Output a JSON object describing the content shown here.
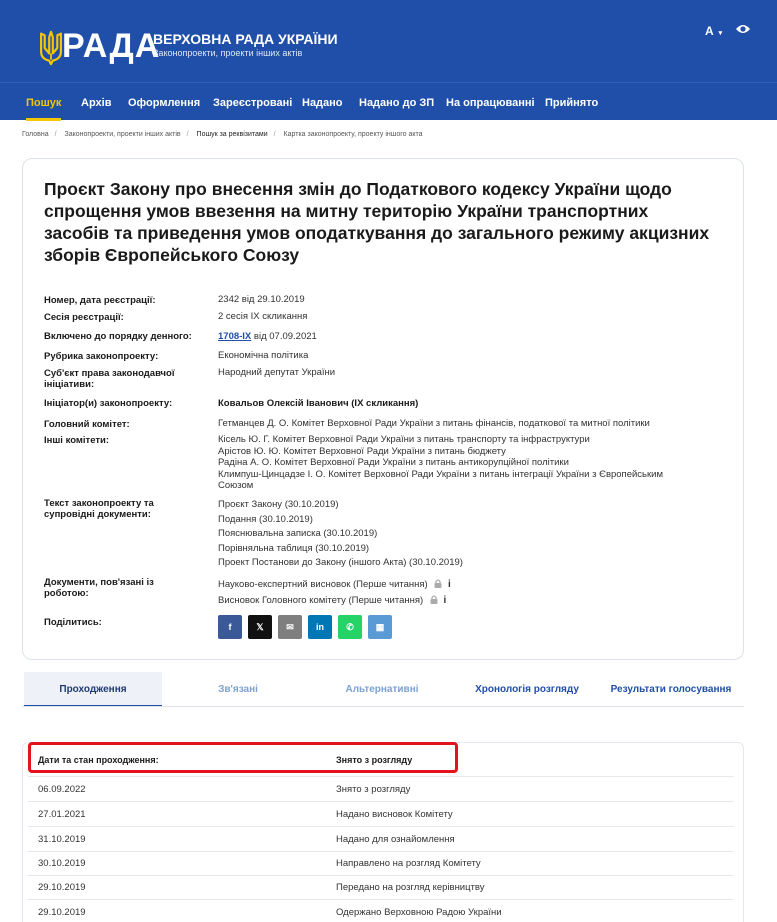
{
  "header": {
    "logo_text": "РАДА",
    "site_title": "ВЕРХОВНА РАДА УКРАЇНИ",
    "site_subtitle": "Законопроекти, проекти інших актів",
    "font_switch": "A",
    "brand_color": "#1f4fa8",
    "accent_color": "#f5c700"
  },
  "nav": {
    "items": [
      "Пошук",
      "Архів",
      "Оформлення",
      "Зареєстровані",
      "Надано",
      "Надано до ЗП",
      "На опрацюванні",
      "Прийнято"
    ],
    "active": "Пошук"
  },
  "breadcrumb": [
    "Головна",
    "Законопроекти, проекти інших актів",
    "Пошук за реквізитами",
    "Картка законопроекту, проекту іншого акта"
  ],
  "bill": {
    "title": "Проєкт Закону про внесення змін до Податкового кодексу України щодо спрощення умов ввезення на митну територію України транспортних засобів та приведення умов оподаткування до загального режиму акцизних зборів Європейського Союзу",
    "fields": {
      "reg_label": "Номер, дата реєстрації:",
      "reg_value": "2342 від 29.10.2019",
      "session_label": "Сесія реєстрації:",
      "session_value": "2 сесія IX скликання",
      "agenda_label": "Включено до порядку денного:",
      "agenda_number": "1708-IX",
      "agenda_date": "від 07.09.2021",
      "rubric_label": "Рубрика законопроекту:",
      "rubric_value": "Економічна політика",
      "subject_label": "Суб'єкт права законодавчої ініціативи:",
      "subject_value": "Народний депутат України",
      "initiator_label": "Ініціатор(и) законопроекту:",
      "initiator_value": "Ковальов Олексій Іванович (IX скликання)",
      "main_committee_label": "Головний комітет:",
      "main_committee_value": "Гетманцев Д. О. Комітет Верховної Ради України з питань фінансів, податкової та митної політики",
      "other_committees_label": "Інші комітети:",
      "other_committees": [
        "Кісель Ю. Г. Комітет Верховної Ради України з питань транспорту та інфраструктури",
        "Арістов Ю. Ю. Комітет Верховної Ради України з питань бюджету",
        "Радіна А. О. Комітет Верховної Ради України з питань антикорупційної політики",
        "Климпуш-Цинцадзе І. О. Комітет Верховної Ради України з питань інтеграції України з Європейським",
        "Союзом"
      ],
      "docs_label": "Текст законопроекту та супровідні документи:",
      "docs": [
        "Проєкт Закону (30.10.2019)",
        "Подання (30.10.2019)",
        "Пояснювальна записка (30.10.2019)",
        "Порівняльна таблиця (30.10.2019)",
        "Проект Постанови до Закону (іншого Акта) (30.10.2019)"
      ],
      "related_label": "Документи, пов'язані із роботою:",
      "related_docs": [
        "Науково-експертний висновок (Перше читання)",
        "Висновок Головного комітету (Перше читання)"
      ],
      "share_label": "Поділитись:"
    },
    "share_buttons": [
      {
        "label": "f",
        "color": "#3b5998"
      },
      {
        "label": "𝕏",
        "color": "#111111"
      },
      {
        "label": "✉",
        "color": "#7f7f7f"
      },
      {
        "label": "in",
        "color": "#0077b5"
      },
      {
        "label": "✆",
        "color": "#25d366"
      },
      {
        "label": "▦",
        "color": "#5b9bd5"
      }
    ]
  },
  "tabs": [
    "Проходження",
    "Зв'язані",
    "Альтернативні",
    "Хронологія розгляду",
    "Результати голосування"
  ],
  "table": {
    "header_date": "Дати та стан проходження:",
    "header_status": "Знято з розгляду",
    "rows": [
      {
        "date": "06.09.2022",
        "status": "Знято з розгляду"
      },
      {
        "date": "27.01.2021",
        "status": "Надано висновок Комітету"
      },
      {
        "date": "31.10.2019",
        "status": "Надано для ознайомлення"
      },
      {
        "date": "30.10.2019",
        "status": "Направлено на розгляд Комітету"
      },
      {
        "date": "29.10.2019",
        "status": "Передано на розгляд керівництву"
      },
      {
        "date": "29.10.2019",
        "status": "Одержано Верховною Радою України"
      }
    ]
  }
}
